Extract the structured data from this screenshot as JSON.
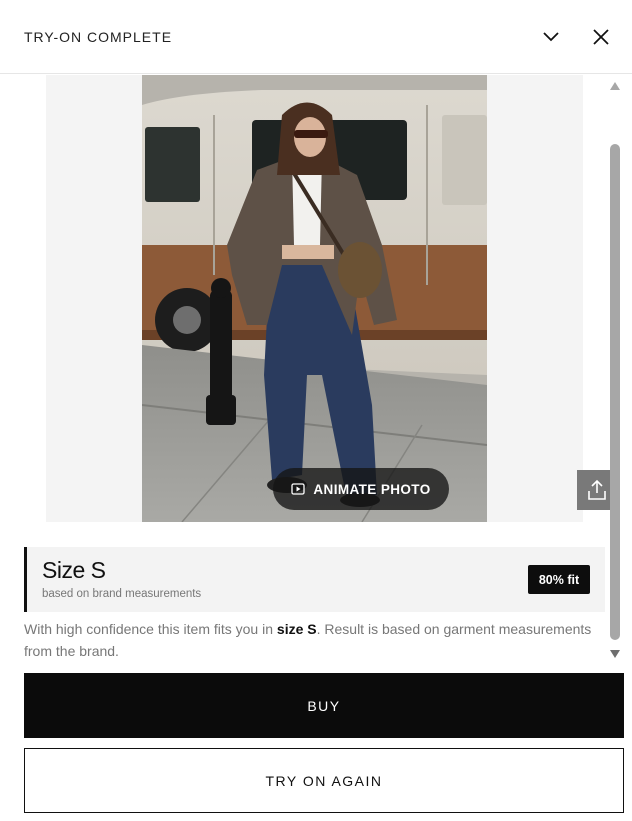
{
  "header": {
    "title": "TRY-ON COMPLETE",
    "collapse_icon": "chevron-down-icon",
    "close_icon": "close-icon"
  },
  "result": {
    "animate_label": "ANIMATE PHOTO",
    "animate_icon": "play-icon",
    "share_icon": "share-icon"
  },
  "size": {
    "title": "Size S",
    "subtitle": "based on brand measurements",
    "fit_badge": "80% fit"
  },
  "confidence": {
    "prefix": "With high confidence this item fits you in ",
    "size": "size S",
    "suffix": ". Result is based on garment measurements from the brand."
  },
  "actions": {
    "buy_label": "BUY",
    "try_again_label": "TRY ON AGAIN"
  },
  "colors": {
    "primary": "#0b0b0b",
    "card_bg": "#f3f3f3",
    "muted_text": "#777777"
  }
}
